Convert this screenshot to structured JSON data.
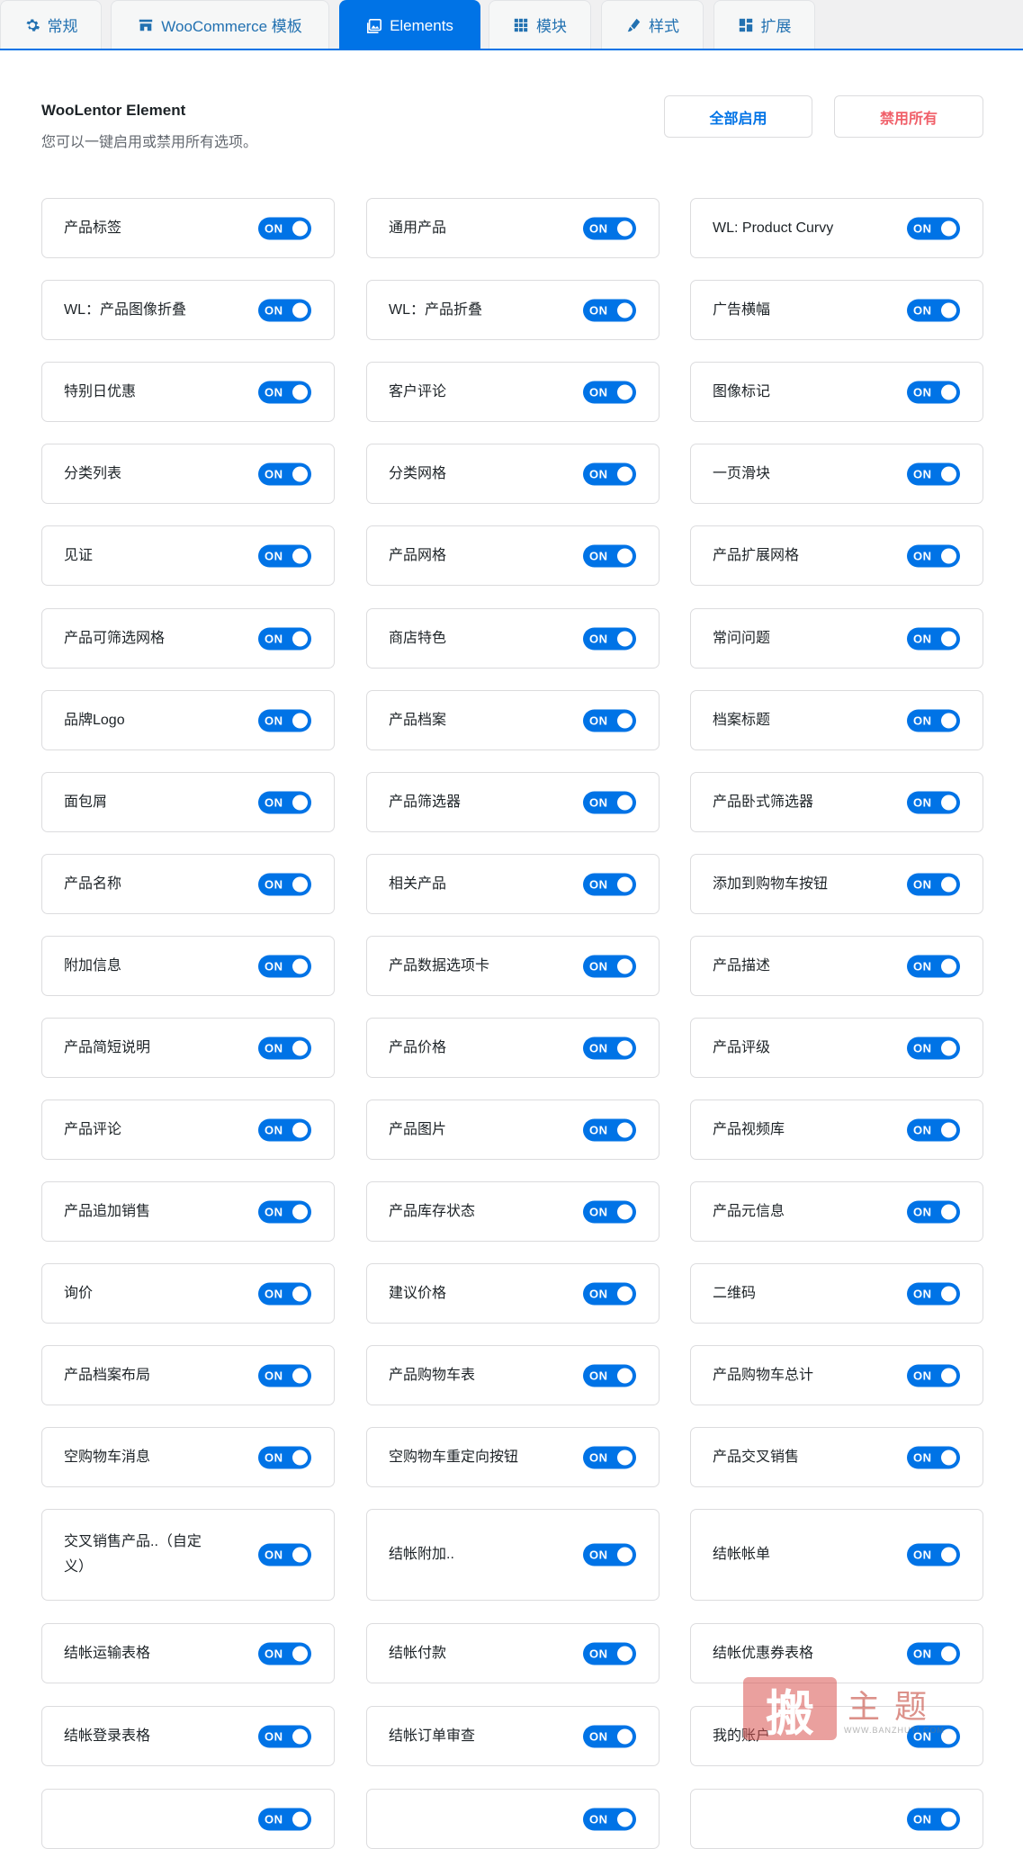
{
  "tabs": [
    {
      "label": "常规",
      "icon": "gear-icon",
      "active": false
    },
    {
      "label": "WooCommerce 模板",
      "icon": "store-icon",
      "active": false
    },
    {
      "label": "Elements",
      "icon": "image-gallery-icon",
      "active": true
    },
    {
      "label": "模块",
      "icon": "grid-icon",
      "active": false
    },
    {
      "label": "样式",
      "icon": "brush-icon",
      "active": false
    },
    {
      "label": "扩展",
      "icon": "blocks-icon",
      "active": false
    }
  ],
  "section": {
    "title": "WooLentor Element",
    "description": "您可以一键启用或禁用所有选项。",
    "enable_all_label": "全部启用",
    "disable_all_label": "禁用所有"
  },
  "toggle_on_label": "ON",
  "accent_color": "#0073e6",
  "disable_color": "#f0606a",
  "elements": [
    "产品标签",
    "通用产品",
    "WL: Product Curvy",
    "WL：产品图像折叠",
    "WL：产品折叠",
    "广告横幅",
    "特别日优惠",
    "客户评论",
    "图像标记",
    "分类列表",
    "分类网格",
    "一页滑块",
    "见证",
    "产品网格",
    "产品扩展网格",
    "产品可筛选网格",
    "商店特色",
    "常问问题",
    "品牌Logo",
    "产品档案",
    "档案标题",
    "面包屑",
    "产品筛选器",
    "产品卧式筛选器",
    "产品名称",
    "相关产品",
    "添加到购物车按钮",
    "附加信息",
    "产品数据选项卡",
    "产品描述",
    "产品简短说明",
    "产品价格",
    "产品评级",
    "产品评论",
    "产品图片",
    "产品视频库",
    "产品追加销售",
    "产品库存状态",
    "产品元信息",
    "询价",
    "建议价格",
    "二维码",
    "产品档案布局",
    "产品购物车表",
    "产品购物车总计",
    "空购物车消息",
    "空购物车重定向按钮",
    "产品交叉销售",
    "交叉销售产品..（自定义）",
    "结帐附加..",
    "结帐帐单",
    "结帐运输表格",
    "结帐付款",
    "结帐优惠券表格",
    "结帐登录表格",
    "结帐订单审查",
    "我的账户",
    "",
    "",
    ""
  ],
  "watermark": {
    "seal": "搬",
    "text": "主题",
    "url": "WWW.BANZHUTI.COM"
  }
}
